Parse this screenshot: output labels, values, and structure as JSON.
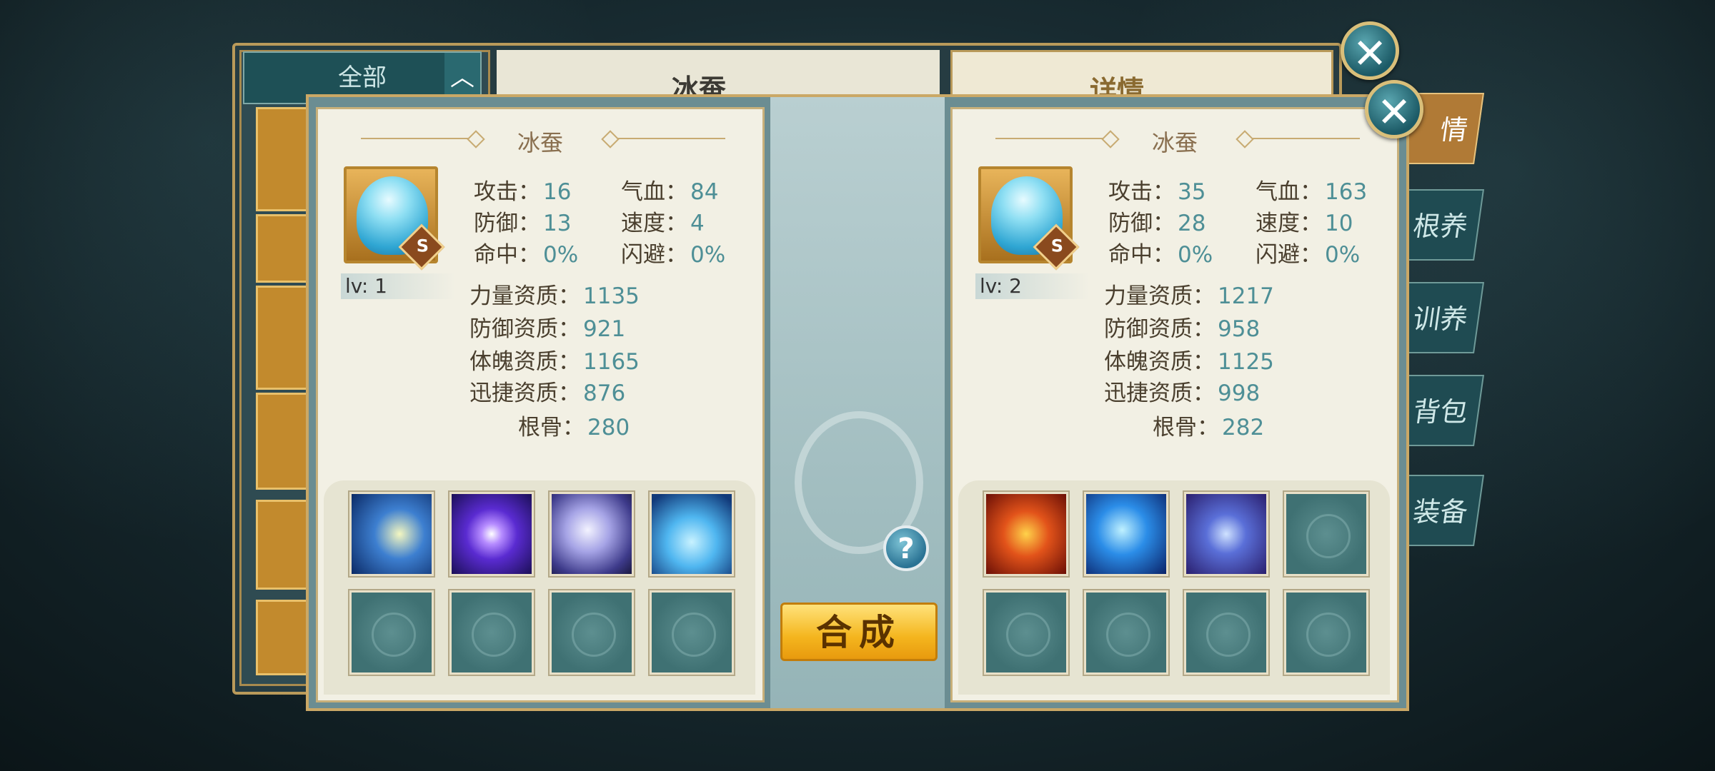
{
  "background": {
    "filter_label": "全部",
    "center_title": "冰蚕",
    "right_title": "详情",
    "side_tabs": [
      "情",
      "根养",
      "训养",
      "背包",
      "装备"
    ]
  },
  "modal": {
    "left": {
      "name": "冰蚕",
      "level": "lv: 1",
      "rank": "S",
      "stats": [
        {
          "k": "攻击：",
          "v": "16"
        },
        {
          "k": "气血：",
          "v": "84"
        },
        {
          "k": "防御：",
          "v": "13"
        },
        {
          "k": "速度：",
          "v": "4"
        },
        {
          "k": "命中：",
          "v": "0%"
        },
        {
          "k": "闪避：",
          "v": "0%"
        }
      ],
      "aptitudes": [
        {
          "k": "力量资质：",
          "v": "1135"
        },
        {
          "k": "防御资质：",
          "v": "921"
        },
        {
          "k": "体魄资质：",
          "v": "1165"
        },
        {
          "k": "迅捷资质：",
          "v": "876"
        },
        {
          "k": "根骨：",
          "v": "280"
        }
      ],
      "skills": [
        "lightning-slash-skill-icon",
        "purple-orb-skill-icon",
        "silver-sphere-skill-icon",
        "blue-heart-skill-icon"
      ]
    },
    "right": {
      "name": "冰蚕",
      "level": "lv: 2",
      "rank": "S",
      "stats": [
        {
          "k": "攻击：",
          "v": "35"
        },
        {
          "k": "气血：",
          "v": "163"
        },
        {
          "k": "防御：",
          "v": "28"
        },
        {
          "k": "速度：",
          "v": "10"
        },
        {
          "k": "命中：",
          "v": "0%"
        },
        {
          "k": "闪避：",
          "v": "0%"
        }
      ],
      "aptitudes": [
        {
          "k": "力量资质：",
          "v": "1217"
        },
        {
          "k": "防御资质：",
          "v": "958"
        },
        {
          "k": "体魄资质：",
          "v": "1125"
        },
        {
          "k": "迅捷资质：",
          "v": "998"
        },
        {
          "k": "根骨：",
          "v": "282"
        }
      ],
      "skills": [
        "fire-orb-skill-icon",
        "blue-beast-skill-icon",
        "shield-skill-icon"
      ]
    },
    "merge_label": "合成",
    "help_label": "?",
    "close_label": "✕"
  }
}
